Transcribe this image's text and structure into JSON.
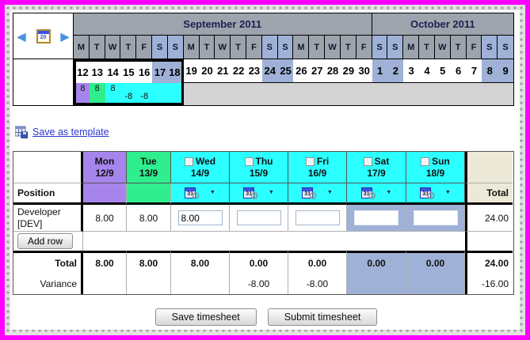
{
  "colors": {
    "frame": "#ff00ff",
    "mon": "#a784ec",
    "tue": "#2fee8e",
    "cyan": "#2bffff",
    "weekend": "#9fb1d6",
    "strip-gray": "#9ea4ad",
    "values-gray": "#d4d4d4",
    "total-beige": "#ece9d8",
    "navy": "#1a2150",
    "link": "#2a35cc"
  },
  "icons": {
    "prev": "◀",
    "next": "▶",
    "gear": "⚙",
    "dropdown": "▼",
    "nav_cal_day": "20",
    "picker_cal_day": "31"
  },
  "calendar_strip": {
    "months": {
      "september": "September 2011",
      "october": "October 2011"
    },
    "days": [
      {
        "letter": "M",
        "date": "12"
      },
      {
        "letter": "T",
        "date": "13"
      },
      {
        "letter": "W",
        "date": "14"
      },
      {
        "letter": "T",
        "date": "15"
      },
      {
        "letter": "F",
        "date": "16"
      },
      {
        "letter": "S",
        "date": "17"
      },
      {
        "letter": "S",
        "date": "18"
      },
      {
        "letter": "M",
        "date": "19"
      },
      {
        "letter": "T",
        "date": "20"
      },
      {
        "letter": "W",
        "date": "21"
      },
      {
        "letter": "T",
        "date": "22"
      },
      {
        "letter": "F",
        "date": "23"
      },
      {
        "letter": "S",
        "date": "24"
      },
      {
        "letter": "S",
        "date": "25"
      },
      {
        "letter": "M",
        "date": "26"
      },
      {
        "letter": "T",
        "date": "27"
      },
      {
        "letter": "W",
        "date": "28"
      },
      {
        "letter": "T",
        "date": "29"
      },
      {
        "letter": "F",
        "date": "30"
      },
      {
        "letter": "S",
        "date": "1"
      },
      {
        "letter": "S",
        "date": "2"
      },
      {
        "letter": "M",
        "date": "3"
      },
      {
        "letter": "T",
        "date": "4"
      },
      {
        "letter": "W",
        "date": "5"
      },
      {
        "letter": "T",
        "date": "6"
      },
      {
        "letter": "F",
        "date": "7"
      },
      {
        "letter": "S",
        "date": "8"
      },
      {
        "letter": "S",
        "date": "9"
      }
    ],
    "week_values": {
      "d12": "8",
      "d13": "8",
      "d14": "8",
      "d15": "-8",
      "d16": "-8"
    }
  },
  "template_link": {
    "label": "Save as template"
  },
  "timesheet": {
    "position_label": "Position",
    "total_label": "Total",
    "columns": [
      {
        "day": "Mon",
        "date": "12/9"
      },
      {
        "day": "Tue",
        "date": "13/9"
      },
      {
        "day": "Wed",
        "date": "14/9"
      },
      {
        "day": "Thu",
        "date": "15/9"
      },
      {
        "day": "Fri",
        "date": "16/9"
      },
      {
        "day": "Sat",
        "date": "17/9"
      },
      {
        "day": "Sun",
        "date": "18/9"
      }
    ],
    "row": {
      "name": "Developer",
      "code": "[DEV]",
      "mon": "8.00",
      "tue": "8.00",
      "wed_input": "8.00",
      "thu_input": "",
      "fri_input": "",
      "sat_input": "",
      "sun_input": "",
      "total": "24.00"
    },
    "add_row_label": "Add row",
    "totals": {
      "label": "Total",
      "mon": "8.00",
      "tue": "8.00",
      "wed": "8.00",
      "thu": "0.00",
      "fri": "0.00",
      "sat": "0.00",
      "sun": "0.00",
      "total": "24.00"
    },
    "variance": {
      "label": "Variance",
      "thu": "-8.00",
      "fri": "-8.00",
      "total": "-16.00"
    }
  },
  "actions": {
    "save": "Save timesheet",
    "submit": "Submit timesheet"
  }
}
